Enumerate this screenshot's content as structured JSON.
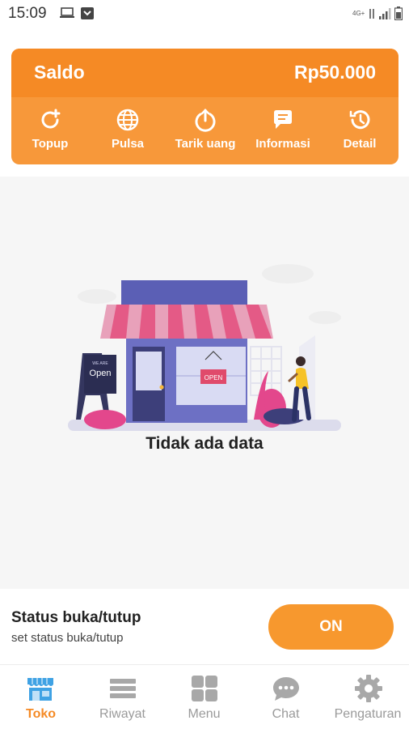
{
  "statusbar": {
    "time": "15:09",
    "network": "4G+"
  },
  "balance": {
    "label": "Saldo",
    "amount": "Rp50.000"
  },
  "actions": [
    {
      "label": "Topup",
      "icon": "topup-icon"
    },
    {
      "label": "Pulsa",
      "icon": "globe-icon"
    },
    {
      "label": "Tarik uang",
      "icon": "withdraw-icon"
    },
    {
      "label": "Informasi",
      "icon": "chat-bubble-icon"
    },
    {
      "label": "Detail",
      "icon": "history-icon"
    }
  ],
  "empty_state": {
    "message": "Tidak ada data",
    "sign_open": "OPEN",
    "board_text": "Open",
    "board_small": "WE ARE"
  },
  "store_status": {
    "title": "Status buka/tutup",
    "subtitle": "set status buka/tutup",
    "toggle_label": "ON"
  },
  "bottom_nav": [
    {
      "label": "Toko",
      "icon": "store-icon",
      "active": true
    },
    {
      "label": "Riwayat",
      "icon": "list-icon",
      "active": false
    },
    {
      "label": "Menu",
      "icon": "grid-icon",
      "active": false
    },
    {
      "label": "Chat",
      "icon": "chat-icon",
      "active": false
    },
    {
      "label": "Pengaturan",
      "icon": "gear-icon",
      "active": false
    }
  ],
  "colors": {
    "accent": "#f58a25",
    "accent_light": "#f7983a",
    "inactive": "#9a9a9a",
    "store_active": "#4aa3df"
  }
}
